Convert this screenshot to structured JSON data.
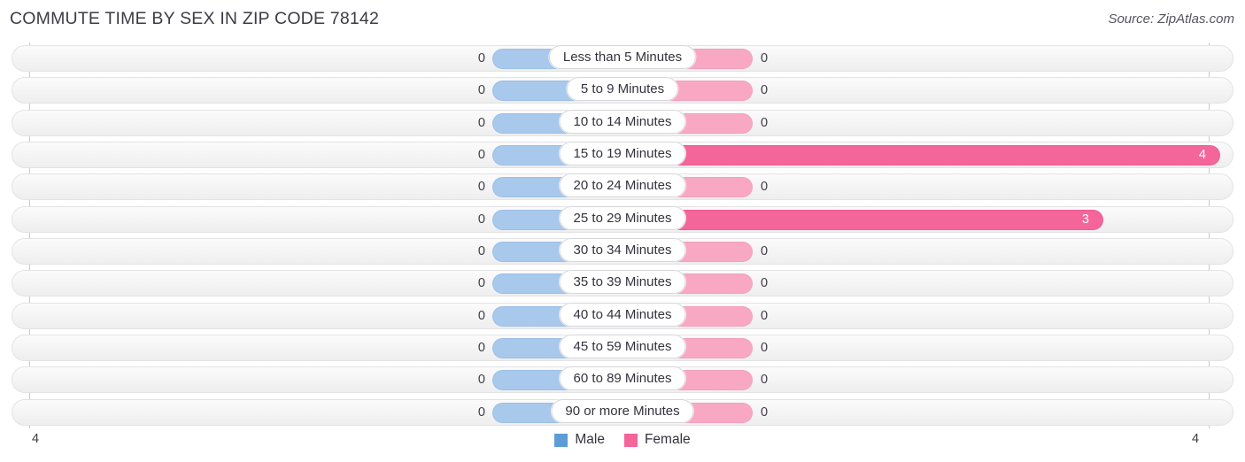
{
  "header": {
    "title": "COMMUTE TIME BY SEX IN ZIP CODE 78142",
    "source": "Source: ZipAtlas.com"
  },
  "legend": {
    "male_label": "Male",
    "female_label": "Female",
    "male_color": "#5d9cd6",
    "female_color": "#f4659a"
  },
  "axis": {
    "left_max_label": "4",
    "right_max_label": "4"
  },
  "chart_data": {
    "type": "bar",
    "orientation": "horizontal-diverging",
    "title": "COMMUTE TIME BY SEX IN ZIP CODE 78142",
    "xlabel": "",
    "ylabel": "",
    "xlim": [
      4,
      4
    ],
    "grid": false,
    "legend_position": "bottom-center",
    "categories": [
      "Less than 5 Minutes",
      "5 to 9 Minutes",
      "10 to 14 Minutes",
      "15 to 19 Minutes",
      "20 to 24 Minutes",
      "25 to 29 Minutes",
      "30 to 34 Minutes",
      "35 to 39 Minutes",
      "40 to 44 Minutes",
      "45 to 59 Minutes",
      "60 to 89 Minutes",
      "90 or more Minutes"
    ],
    "series": [
      {
        "name": "Male",
        "color": "#a8c8ec",
        "values": [
          0,
          0,
          0,
          0,
          0,
          0,
          0,
          0,
          0,
          0,
          0,
          0
        ]
      },
      {
        "name": "Female",
        "color": "#f4659a",
        "values": [
          0,
          0,
          0,
          4,
          0,
          3,
          0,
          0,
          0,
          0,
          0,
          0
        ]
      }
    ]
  },
  "rows": [
    {
      "label": "Less than 5 Minutes",
      "male": "0",
      "female": "0"
    },
    {
      "label": "5 to 9 Minutes",
      "male": "0",
      "female": "0"
    },
    {
      "label": "10 to 14 Minutes",
      "male": "0",
      "female": "0"
    },
    {
      "label": "15 to 19 Minutes",
      "male": "0",
      "female": "4"
    },
    {
      "label": "20 to 24 Minutes",
      "male": "0",
      "female": "0"
    },
    {
      "label": "25 to 29 Minutes",
      "male": "0",
      "female": "3"
    },
    {
      "label": "30 to 34 Minutes",
      "male": "0",
      "female": "0"
    },
    {
      "label": "35 to 39 Minutes",
      "male": "0",
      "female": "0"
    },
    {
      "label": "40 to 44 Minutes",
      "male": "0",
      "female": "0"
    },
    {
      "label": "45 to 59 Minutes",
      "male": "0",
      "female": "0"
    },
    {
      "label": "60 to 89 Minutes",
      "male": "0",
      "female": "0"
    },
    {
      "label": "90 or more Minutes",
      "male": "0",
      "female": "0"
    }
  ]
}
